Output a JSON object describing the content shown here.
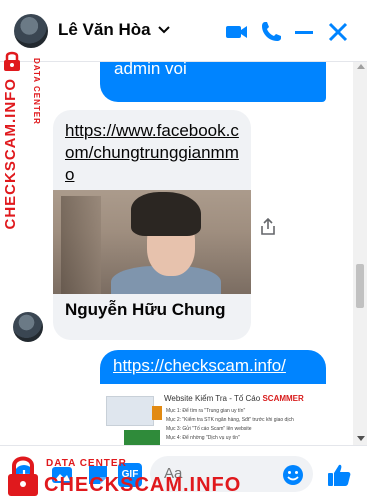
{
  "header": {
    "contact_name": "Lê Văn Hòa",
    "icons": [
      "chevron-down-icon",
      "video-call-icon",
      "phone-icon",
      "minimize-icon",
      "close-icon"
    ],
    "accent": "#0084ff"
  },
  "messages": {
    "outgoing_1": "bac gui link may ong admin voi",
    "shared_link": "https://www.facebook.com/chungtrunggianmmo",
    "shared_name": "Nguyễn Hữu Chung",
    "outgoing_2_link": "https://checkscam.info/",
    "preview": {
      "title_prefix": "Website",
      "title_middle": "Kiểm Tra - Tố Cáo",
      "title_accent": "SCAMMER",
      "lines": [
        "Mục 1: Để tìm ra \"Trung gian uy tín\"",
        "Mục 2: \"Kiểm tra STK ngân hàng, Sđt\" trước khi giao dịch",
        "Mục 3: Gửi \"Tố cáo Scam\" lên website",
        "Mục 4: Để nhờng \"Dịch vụ uy tín\""
      ]
    }
  },
  "composer": {
    "placeholder": "Aa",
    "icons": [
      "plus-circle-icon",
      "image-icon",
      "sticker-icon",
      "gif-icon",
      "emoji-icon",
      "like-icon"
    ],
    "gif_label": "GIF"
  },
  "watermark": {
    "side_text": "CHECKSCAM.INFO",
    "side_small": "DATA CENTER",
    "bottom_small": "DATA CENTER",
    "bottom_text": "CHECKSCAM.INFO",
    "color": "#e0191d"
  }
}
